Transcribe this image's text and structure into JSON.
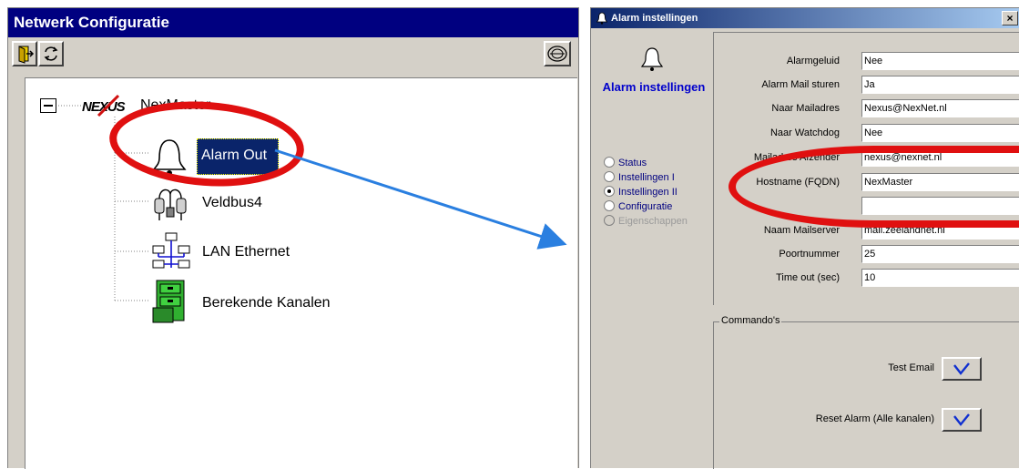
{
  "left_window": {
    "title": "Netwerk Configuratie",
    "toolbar": {
      "icons": [
        "exit-door-icon",
        "refresh-icon",
        "sync-globe-icon"
      ]
    },
    "tree": {
      "root": {
        "logo_text": "NEXUS",
        "label": "NexMaster"
      },
      "children": [
        {
          "label": "Alarm Out",
          "icon": "bell-icon",
          "selected": true
        },
        {
          "label": "Veldbus4",
          "icon": "fieldbus-plugs-icon"
        },
        {
          "label": "LAN Ethernet",
          "icon": "lan-network-icon"
        },
        {
          "label": "Berekende Kanalen",
          "icon": "filing-cabinet-icon"
        }
      ]
    }
  },
  "right_window": {
    "title": "Alarm instellingen",
    "close_glyph": "×",
    "sidebar": {
      "title": "Alarm instellingen",
      "options": [
        {
          "label": "Status",
          "selected": false,
          "disabled": false
        },
        {
          "label": "Instellingen I",
          "selected": false,
          "disabled": false
        },
        {
          "label": "Instellingen II",
          "selected": true,
          "disabled": false
        },
        {
          "label": "Configuratie",
          "selected": false,
          "disabled": false
        },
        {
          "label": "Eigenschappen",
          "selected": false,
          "disabled": true
        }
      ]
    },
    "fields": [
      {
        "label": "Alarmgeluid",
        "value": "Nee"
      },
      {
        "label": "Alarm Mail sturen",
        "value": "Ja"
      },
      {
        "label": "Naar Mailadres",
        "value": "Nexus@NexNet.nl"
      },
      {
        "label": "Naar Watchdog",
        "value": "Nee"
      },
      {
        "label": "Mailadres Afzender",
        "value": "nexus@nexnet.nl"
      },
      {
        "label": "Hostname (FQDN)",
        "value": "NexMaster"
      },
      {
        "label": "",
        "value": ""
      },
      {
        "label": "Naam Mailserver",
        "value": "mail.zeelandnet.nl"
      },
      {
        "label": "Poortnummer",
        "value": "25"
      },
      {
        "label": "Time out (sec)",
        "value": "10"
      }
    ],
    "commands": {
      "legend": "Commando's",
      "items": [
        {
          "label": "Test Email"
        },
        {
          "label": "Reset Alarm (Alle kanalen)"
        }
      ]
    }
  },
  "colors": {
    "highlight_ellipse": "#e01010",
    "arrow": "#2a7fe0",
    "left_titlebar": "#000080",
    "selection": "#0a246a",
    "link_text": "#0000cc"
  }
}
